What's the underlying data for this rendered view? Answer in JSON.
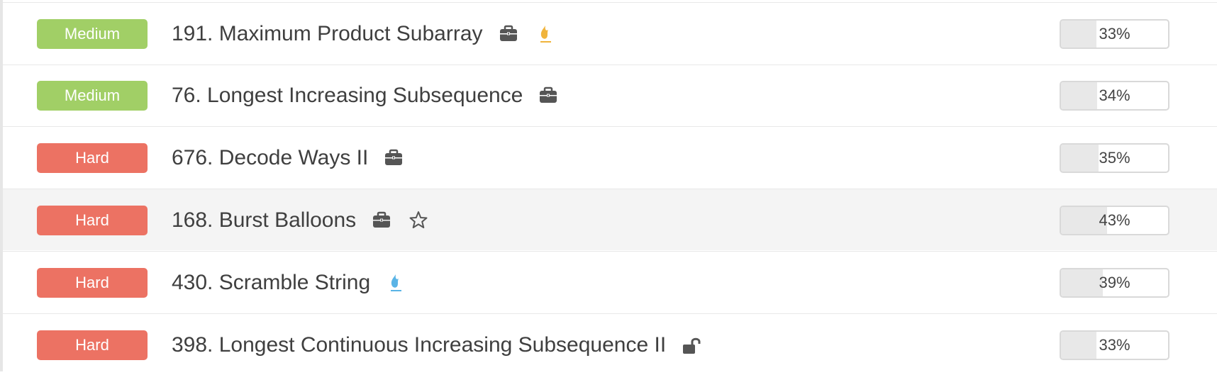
{
  "problems": [
    {
      "difficulty": "Medium",
      "title": "191. Maximum Product Subarray",
      "icons": [
        "briefcase-icon",
        "fire-icon-yellow"
      ],
      "acceptance": "33%",
      "acceptance_value": 0.33,
      "highlighted": false
    },
    {
      "difficulty": "Medium",
      "title": "76. Longest Increasing Subsequence",
      "icons": [
        "briefcase-icon"
      ],
      "acceptance": "34%",
      "acceptance_value": 0.34,
      "highlighted": false
    },
    {
      "difficulty": "Hard",
      "title": "676. Decode Ways II",
      "icons": [
        "briefcase-icon"
      ],
      "acceptance": "35%",
      "acceptance_value": 0.35,
      "highlighted": false
    },
    {
      "difficulty": "Hard",
      "title": "168. Burst Balloons",
      "icons": [
        "briefcase-icon",
        "star-icon"
      ],
      "acceptance": "43%",
      "acceptance_value": 0.43,
      "highlighted": true
    },
    {
      "difficulty": "Hard",
      "title": "430. Scramble String",
      "icons": [
        "fire-icon-blue"
      ],
      "acceptance": "39%",
      "acceptance_value": 0.39,
      "highlighted": false
    },
    {
      "difficulty": "Hard",
      "title": "398. Longest Continuous Increasing Subsequence II",
      "icons": [
        "unlock-icon"
      ],
      "acceptance": "33%",
      "acceptance_value": 0.33,
      "highlighted": false
    }
  ],
  "colors": {
    "medium": "#a1cf66",
    "hard": "#ec7263",
    "fire_yellow": "#f0b43c",
    "fire_blue": "#5ab4e6",
    "icon_dark": "#555555"
  }
}
